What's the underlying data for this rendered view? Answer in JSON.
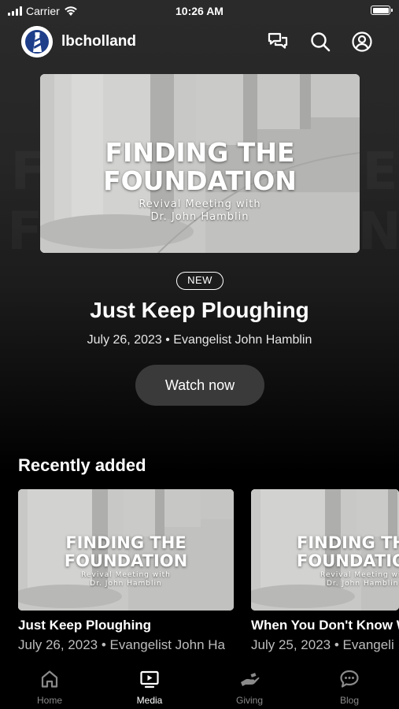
{
  "status_bar": {
    "carrier": "Carrier",
    "time": "10:26 AM"
  },
  "header": {
    "brand": "lbcholland"
  },
  "hero": {
    "thumbnail_title_line1": "FINDING THE",
    "thumbnail_title_line2": "FOUNDATION",
    "thumbnail_subtitle_line1": "Revival Meeting with",
    "thumbnail_subtitle_line2": "Dr. John Hamblin",
    "badge": "NEW",
    "title": "Just Keep Ploughing",
    "meta": "July 26, 2023 • Evangelist John Hamblin",
    "watch_label": "Watch now"
  },
  "recently_added": {
    "heading": "Recently added",
    "items": [
      {
        "thumbnail_title_line1": "FINDING THE",
        "thumbnail_title_line2": "FOUNDATION",
        "thumbnail_subtitle_line1": "Revival Meeting with",
        "thumbnail_subtitle_line2": "Dr. John Hamblin",
        "title": "Just Keep Ploughing",
        "meta": "July 26, 2023 • Evangelist John Ha"
      },
      {
        "thumbnail_title_line1": "FINDING TH",
        "thumbnail_title_line2": "FOUNDATIO",
        "thumbnail_subtitle_line1": "Revival Meeting with",
        "thumbnail_subtitle_line2": "Dr. John Hamblin",
        "title": "When You Don't Know W",
        "meta": "July 25, 2023 • Evangeli"
      }
    ]
  },
  "tabs": [
    {
      "label": "Home",
      "icon": "home-icon",
      "active": false
    },
    {
      "label": "Media",
      "icon": "tv-icon",
      "active": true
    },
    {
      "label": "Giving",
      "icon": "giving-hand-icon",
      "active": false
    },
    {
      "label": "Blog",
      "icon": "chat-bubble-icon",
      "active": false
    }
  ],
  "colors": {
    "background": "#000000",
    "watch_button": "#3a3a3a",
    "inactive_tab": "#8a8a8a"
  }
}
